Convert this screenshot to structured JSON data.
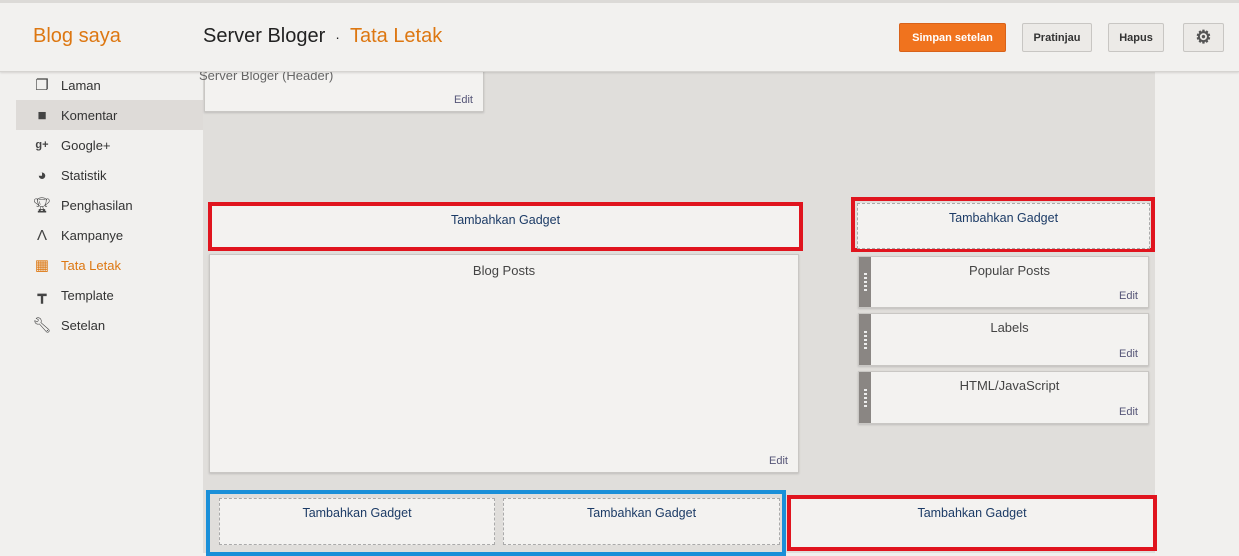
{
  "header": {
    "brand": "Blog saya",
    "blog_name": "Server Bloger",
    "separator": "·",
    "page": "Tata Letak",
    "save": "Simpan setelan",
    "preview": "Pratinjau",
    "delete": "Hapus",
    "settings_icon": "gear-icon"
  },
  "sidebar": {
    "items": [
      {
        "label": "Laman",
        "icon": "pages-icon"
      },
      {
        "label": "Komentar",
        "icon": "comment-icon"
      },
      {
        "label": "Google+",
        "icon": "google-plus-icon"
      },
      {
        "label": "Statistik",
        "icon": "pie-chart-icon"
      },
      {
        "label": "Penghasilan",
        "icon": "trophy-icon"
      },
      {
        "label": "Kampanye",
        "icon": "adwords-icon"
      },
      {
        "label": "Tata Letak",
        "icon": "layout-icon"
      },
      {
        "label": "Template",
        "icon": "paint-roller-icon"
      },
      {
        "label": "Setelan",
        "icon": "wrench-icon"
      }
    ]
  },
  "layout": {
    "header_gadget": {
      "name": "Server Bloger (Header)",
      "edit": "Edit"
    },
    "add_gadget": "Tambahkan Gadget",
    "blog_posts": {
      "name": "Blog Posts",
      "edit": "Edit"
    },
    "sidebar_gadgets": [
      {
        "name": "Popular Posts",
        "edit": "Edit"
      },
      {
        "name": "Labels",
        "edit": "Edit"
      },
      {
        "name": "HTML/JavaScript",
        "edit": "Edit"
      }
    ]
  },
  "colors": {
    "accent": "#dd7711",
    "highlight_red": "#e0141e",
    "highlight_blue": "#1a8fd8",
    "primary_button": "#f0731e"
  }
}
